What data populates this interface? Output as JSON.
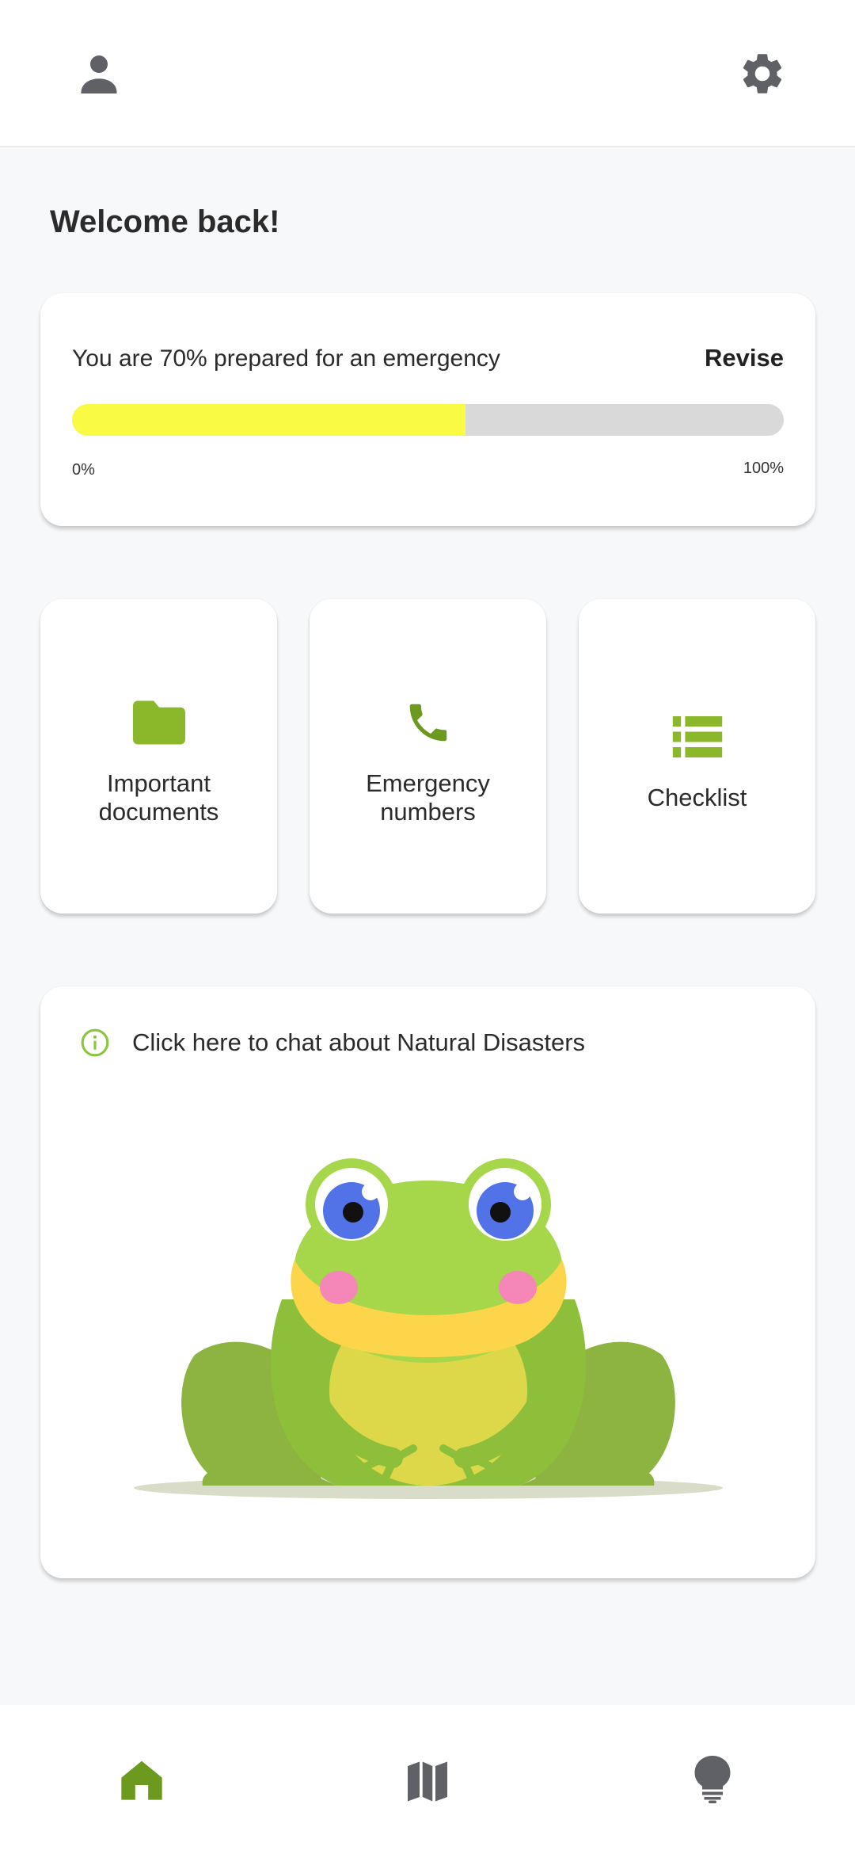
{
  "topbar": {
    "profile_icon": "person-icon",
    "settings_icon": "gear-icon"
  },
  "welcome": {
    "title": "Welcome back!"
  },
  "preparedness": {
    "text": "You are 70% prepared for an emergency",
    "revise_label": "Revise",
    "progress_fraction": 0.553,
    "min_label": "0%",
    "max_label": "100%",
    "fill_color": "#f8fa44",
    "track_color": "#d9d9d9"
  },
  "tiles": [
    {
      "label": "Important\ndocuments",
      "icon": "folder-icon"
    },
    {
      "label": "Emergency\nnumbers",
      "icon": "phone-icon"
    },
    {
      "label": "Checklist",
      "icon": "list-icon"
    }
  ],
  "chat": {
    "text": "Click here to chat about Natural Disasters",
    "icon": "info-icon"
  },
  "bottom_nav": {
    "items": [
      {
        "icon": "home-icon",
        "active": true
      },
      {
        "icon": "map-icon",
        "active": false
      },
      {
        "icon": "lightbulb-icon",
        "active": false
      }
    ]
  },
  "colors": {
    "accent": "#8bb82b",
    "accent_dark": "#6c9a1e",
    "icon_gray": "#5f6166"
  }
}
